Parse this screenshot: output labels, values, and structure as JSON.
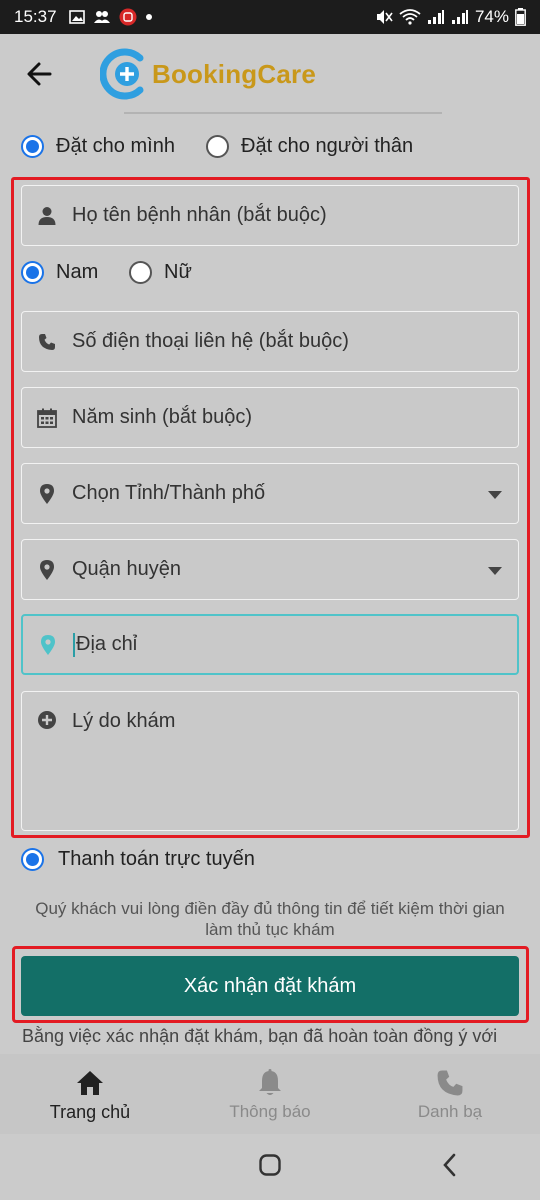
{
  "status": {
    "time": "15:37",
    "battery": "74%"
  },
  "header": {
    "logo_text": "BookingCare"
  },
  "booking_for": {
    "self_label": "Đặt cho mình",
    "relative_label": "Đặt cho người thân",
    "selected": "self"
  },
  "form": {
    "name_placeholder": "Họ tên bệnh nhân (bắt buộc)",
    "gender": {
      "male_label": "Nam",
      "female_label": "Nữ",
      "selected": "male"
    },
    "phone_placeholder": "Số điện thoại liên hệ (bắt buộc)",
    "birth_year_placeholder": "Năm sinh (bắt buộc)",
    "province_label": "Chọn Tỉnh/Thành phố",
    "district_label": "Quận huyện",
    "address_placeholder": "Địa chỉ",
    "reason_placeholder": "Lý do khám"
  },
  "payment": {
    "label": "Thanh toán trực tuyến"
  },
  "note": "Quý khách vui lòng điền đầy đủ thông tin để tiết kiệm thời gian làm thủ tục khám",
  "confirm_label": "Xác nhận đặt khám",
  "terms_text": "Bằng việc xác nhận đặt khám, bạn đã hoàn toàn đồng ý với",
  "tabs": [
    {
      "label": "Trang chủ",
      "icon": "home-icon",
      "active": true
    },
    {
      "label": "Thông báo",
      "icon": "bell-icon",
      "active": false
    },
    {
      "label": "Danh bạ",
      "icon": "phone-icon",
      "active": false
    }
  ],
  "colors": {
    "primary": "#136f67",
    "radio_selected": "#1a73e8",
    "highlight_border": "#e31b23",
    "logo_blue": "#2f9fe0",
    "logo_gold": "#c9981a",
    "focus": "#4fc3c9"
  }
}
